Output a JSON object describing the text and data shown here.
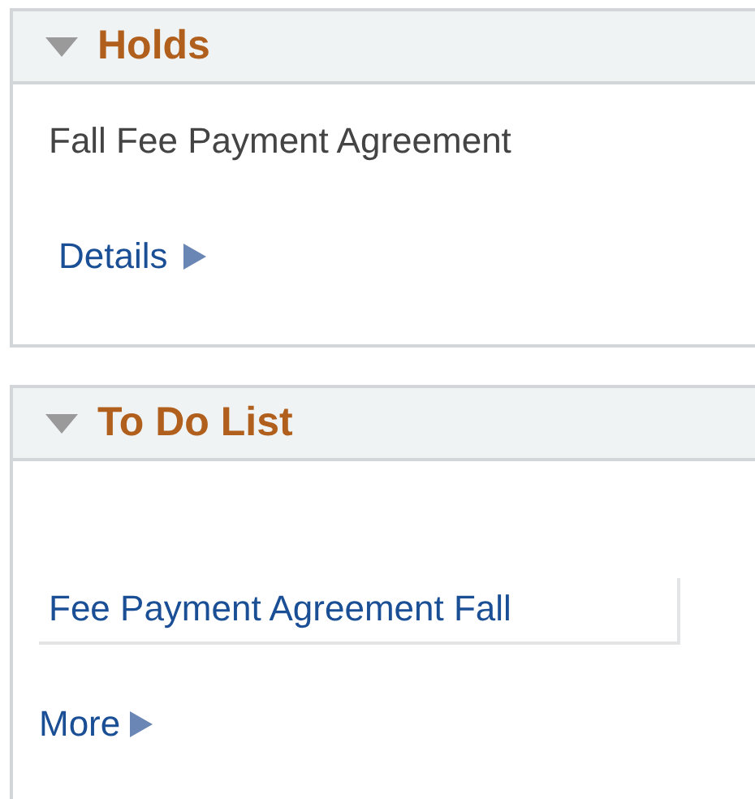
{
  "holds": {
    "title": "Holds",
    "expanded": true,
    "item": "Fall Fee Payment Agreement",
    "link": "Details"
  },
  "todo_list": {
    "title": "To Do List",
    "expanded": true,
    "items": [
      "Fee Payment Agreement Fall"
    ],
    "link": "More"
  }
}
